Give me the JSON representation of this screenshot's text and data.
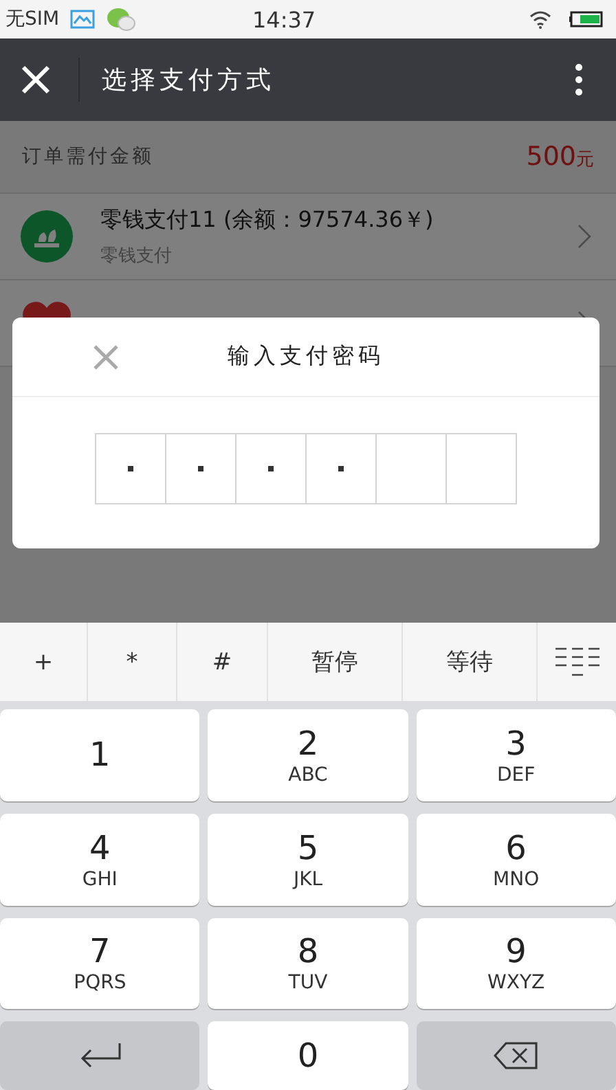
{
  "status_bar": {
    "carrier": "无SIM",
    "time": "14:37"
  },
  "toolbar": {
    "title": "选择支付方式"
  },
  "order": {
    "label": "订单需付金额",
    "amount": "500",
    "unit": "元"
  },
  "payment_methods": [
    {
      "kind": "change",
      "title": "零钱支付11 (余额：97574.36￥)",
      "subtitle": "零钱支付"
    },
    {
      "kind": "heart"
    }
  ],
  "dialog": {
    "title": "输入支付密码",
    "cells": [
      {
        "filled": true
      },
      {
        "filled": true
      },
      {
        "filled": true
      },
      {
        "filled": true
      },
      {
        "filled": false
      },
      {
        "filled": false
      }
    ]
  },
  "keyboard": {
    "top_row": [
      {
        "kind": "text",
        "label": "+"
      },
      {
        "kind": "text",
        "label": "*"
      },
      {
        "kind": "text",
        "label": "#"
      },
      {
        "kind": "text",
        "label": "暂停"
      },
      {
        "kind": "text",
        "label": "等待"
      },
      {
        "kind": "collapse"
      }
    ],
    "keys": [
      {
        "kind": "digit",
        "label": "1"
      },
      {
        "kind": "digit",
        "label": "2",
        "letters": "ABC"
      },
      {
        "kind": "digit",
        "label": "3",
        "letters": "DEF"
      },
      {
        "kind": "digit",
        "label": "4",
        "letters": "GHI"
      },
      {
        "kind": "digit",
        "label": "5",
        "letters": "JKL"
      },
      {
        "kind": "digit",
        "label": "6",
        "letters": "MNO"
      },
      {
        "kind": "digit",
        "label": "7",
        "letters": "PQRS"
      },
      {
        "kind": "digit",
        "label": "8",
        "letters": "TUV"
      },
      {
        "kind": "digit",
        "label": "9",
        "letters": "WXYZ"
      },
      {
        "kind": "enter"
      },
      {
        "kind": "digit",
        "label": "0"
      },
      {
        "kind": "backspace"
      }
    ]
  }
}
